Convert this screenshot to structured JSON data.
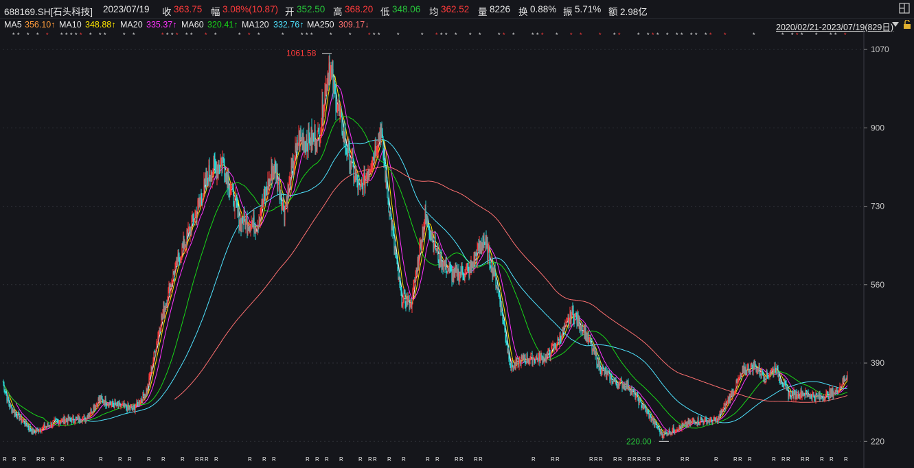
{
  "header": {
    "code": "688169.SH[石头科技]",
    "date": "2023/07/19",
    "close_label": "收",
    "close": "363.75",
    "change_label": "幅",
    "change": "3.08%(10.87)",
    "open_label": "开",
    "open": "352.50",
    "high_label": "高",
    "high": "368.20",
    "low_label": "低",
    "low": "348.06",
    "avg_label": "均",
    "avg": "362.52",
    "vol_label": "量",
    "vol": "8226",
    "turnover_label": "换",
    "turnover": "0.88%",
    "amplitude_label": "振",
    "amplitude": "5.71%",
    "amount_label": "额",
    "amount": "2.98亿"
  },
  "ma_bar": {
    "ma5_label": "MA5",
    "ma5": "356.10↑",
    "ma10_label": "MA10",
    "ma10": "348.88↑",
    "ma20_label": "MA20",
    "ma20": "335.37↑",
    "ma60_label": "MA60",
    "ma60": "320.41↑",
    "ma120_label": "MA120",
    "ma120": "332.76↑",
    "ma250_label": "MA250",
    "ma250": "309.17↓",
    "range": "2020/02/21-2023/07/19(829日)",
    "colors": {
      "ma5": "#ffffff",
      "ma10": "#ffe600",
      "ma20": "#ff33ff",
      "ma60": "#18d618",
      "ma120": "#4fe3ff",
      "ma250": "#ff7070",
      "up": "#ff3b3b",
      "down": "#27d6d6"
    }
  },
  "annotations": {
    "max_label": "1061.58",
    "min_label": "220.00"
  },
  "chart_data": {
    "type": "candlestick",
    "title": "688169.SH[石头科技]",
    "x_range": [
      "2020/02/21",
      "2023/07/19"
    ],
    "trading_days": 829,
    "ylim": [
      210,
      1085
    ],
    "y_ticks": [
      1070,
      900,
      730,
      560,
      390,
      220
    ],
    "max_price": 1061.58,
    "min_price": 220.0,
    "close_key_points": [
      [
        0,
        350
      ],
      [
        10,
        295
      ],
      [
        45,
        240
      ],
      [
        80,
        265
      ],
      [
        120,
        270
      ],
      [
        140,
        310
      ],
      [
        160,
        300
      ],
      [
        190,
        290
      ],
      [
        210,
        330
      ],
      [
        230,
        480
      ],
      [
        250,
        590
      ],
      [
        280,
        710
      ],
      [
        300,
        800
      ],
      [
        320,
        830
      ],
      [
        345,
        700
      ],
      [
        370,
        690
      ],
      [
        395,
        820
      ],
      [
        410,
        720
      ],
      [
        430,
        870
      ],
      [
        460,
        880
      ],
      [
        475,
        1040
      ],
      [
        480,
        1000
      ],
      [
        500,
        860
      ],
      [
        520,
        760
      ],
      [
        540,
        840
      ],
      [
        550,
        900
      ],
      [
        560,
        760
      ],
      [
        580,
        530
      ],
      [
        595,
        520
      ],
      [
        615,
        710
      ],
      [
        635,
        620
      ],
      [
        655,
        580
      ],
      [
        680,
        590
      ],
      [
        700,
        660
      ],
      [
        720,
        560
      ],
      [
        740,
        380
      ],
      [
        760,
        400
      ],
      [
        790,
        400
      ],
      [
        810,
        440
      ],
      [
        830,
        500
      ],
      [
        850,
        450
      ],
      [
        870,
        380
      ],
      [
        890,
        350
      ],
      [
        910,
        340
      ],
      [
        935,
        290
      ],
      [
        960,
        235
      ],
      [
        985,
        250
      ],
      [
        1010,
        265
      ],
      [
        1040,
        265
      ],
      [
        1060,
        320
      ],
      [
        1080,
        375
      ],
      [
        1095,
        385
      ],
      [
        1110,
        360
      ],
      [
        1125,
        380
      ],
      [
        1145,
        320
      ],
      [
        1165,
        325
      ],
      [
        1190,
        315
      ],
      [
        1215,
        330
      ],
      [
        1230,
        364
      ]
    ],
    "ma_series": [
      {
        "name": "MA5",
        "last": 356.1
      },
      {
        "name": "MA10",
        "last": 348.88
      },
      {
        "name": "MA20",
        "last": 335.37
      },
      {
        "name": "MA60",
        "last": 320.41
      },
      {
        "name": "MA120",
        "last": 332.76
      },
      {
        "name": "MA250",
        "last": 309.17
      }
    ],
    "grid": true
  }
}
